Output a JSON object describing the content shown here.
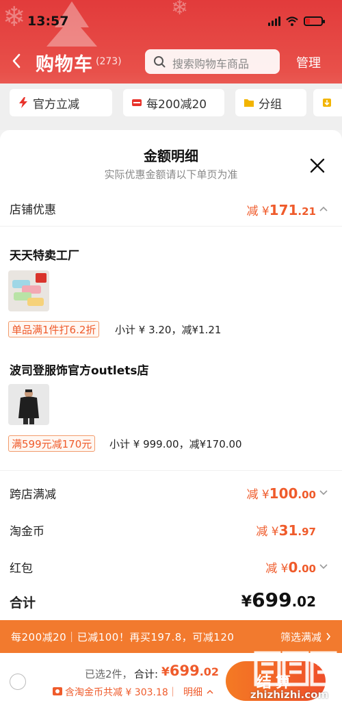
{
  "status_bar": {
    "time": "13:57"
  },
  "nav": {
    "title": "购物车",
    "count": "(273)",
    "search_placeholder": "搜索购物车商品",
    "manage": "管理"
  },
  "filter_chips": [
    {
      "label": "官方立减",
      "icon": "lightning-icon"
    },
    {
      "label": "每200减20",
      "icon": "coupon-icon"
    },
    {
      "label": "分组",
      "icon": "folder-icon"
    }
  ],
  "sheet": {
    "title": "金额明细",
    "subtitle": "实际优惠金额请以下单页为准",
    "store_discount": {
      "label": "店铺优惠",
      "prefix": "减",
      "currency": "¥",
      "int": "171",
      "dec": ".21"
    },
    "stores": [
      {
        "name": "天天特卖工厂",
        "promo": "单品满1件打6.2折",
        "subtotal": "小计 ¥ 3.20，减¥1.21"
      },
      {
        "name": "波司登服饰官方outlets店",
        "promo": "满599元减170元",
        "subtotal": "小计 ¥ 999.00，减¥170.00"
      }
    ],
    "cross_store": {
      "label": "跨店满减",
      "prefix": "减",
      "currency": "¥",
      "int": "100",
      "dec": ".00"
    },
    "tao_coin": {
      "label": "淘金币",
      "prefix": "减",
      "currency": "¥",
      "int": "31",
      "dec": ".97"
    },
    "red_packet": {
      "label": "红包",
      "prefix": "减",
      "currency": "¥",
      "int": "0",
      "dec": ".00"
    },
    "total": {
      "label": "合计",
      "currency": "¥",
      "int": "699",
      "dec": ".02"
    }
  },
  "promo_bar": {
    "text": "每200减20｜已减100！再买197.8，可减120",
    "action": "筛选满减"
  },
  "checkout": {
    "selected": "已选2件，",
    "sum_label": "合计:",
    "currency": "¥",
    "int": "699",
    "dec": ".02",
    "coin_note": "含淘金币共减 ¥ 303.18｜",
    "detail": "明细",
    "button": "结算"
  },
  "watermark": {
    "text": "zhizhizhi.com"
  },
  "colors": {
    "brand_red": "#e23b3b",
    "accent_orange": "#ef5b2b",
    "promo_bar": "#f27a2e"
  }
}
